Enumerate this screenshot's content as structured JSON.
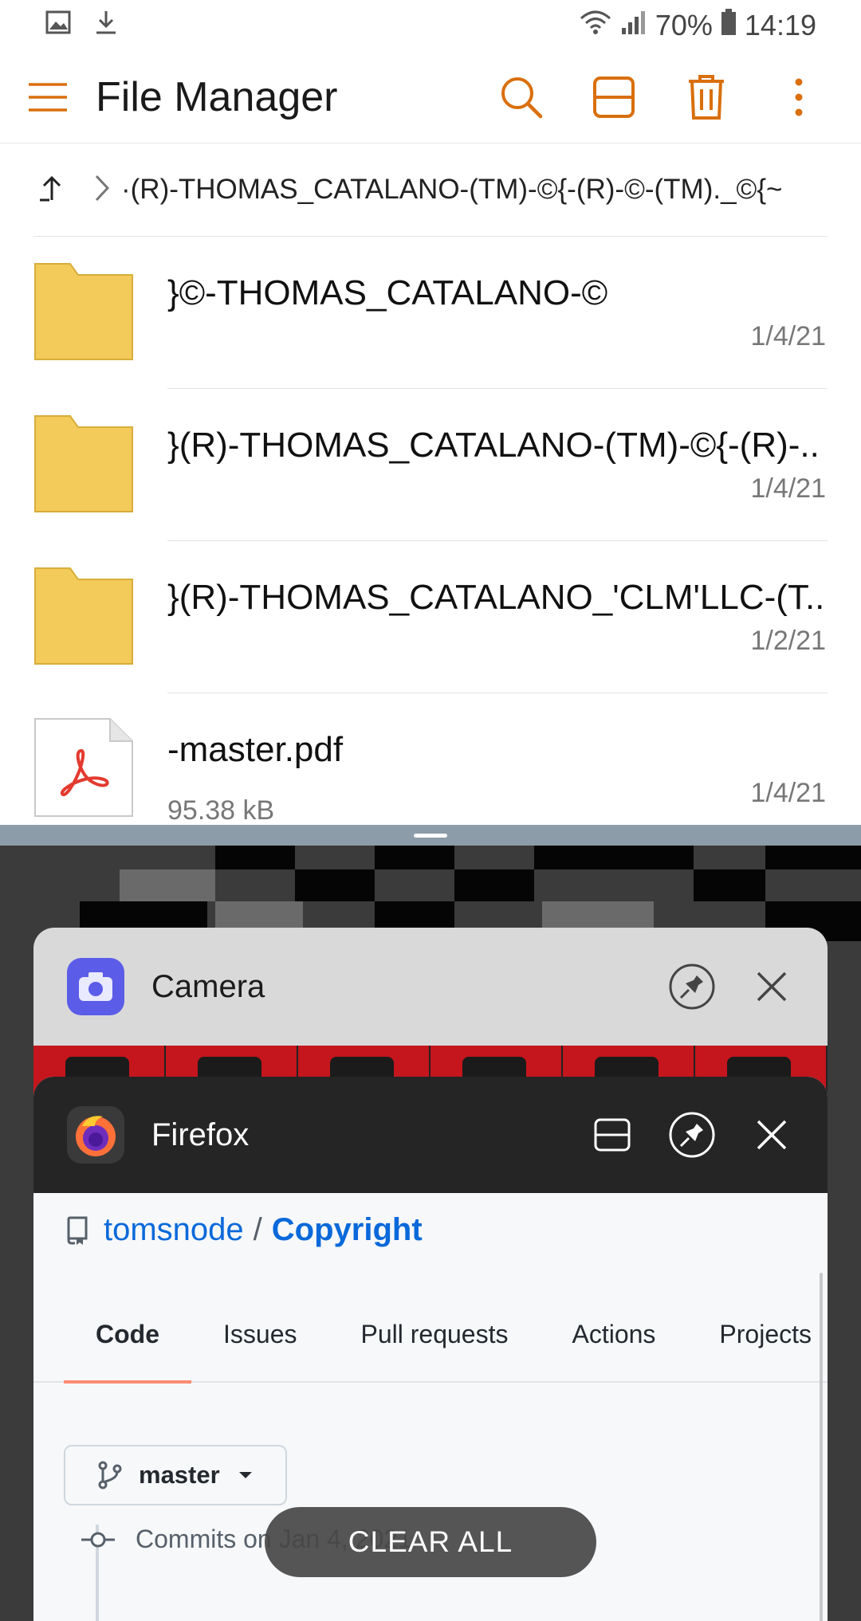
{
  "status_bar": {
    "battery": "70%",
    "time": "14:19",
    "left_icons": [
      "gallery-notification-icon",
      "download-notification-icon"
    ],
    "right_icons": [
      "wifi-icon",
      "signal-icon",
      "battery-icon"
    ]
  },
  "app_bar": {
    "title": "File Manager",
    "accent_color": "#d96f0d",
    "actions": [
      "search-icon",
      "split-view-icon",
      "trash-icon",
      "more-vert-icon"
    ]
  },
  "breadcrumb": {
    "path": "·(R)-THOMAS_CATALANO-(TM)-©{-(R)-©-(TM)._©{~"
  },
  "files": [
    {
      "type": "folder",
      "name": "}©-THOMAS_CATALANO-©",
      "size": "",
      "date": "1/4/21"
    },
    {
      "type": "folder",
      "name": "}(R)-THOMAS_CATALANO-(TM)-©{-(R)-..",
      "size": "",
      "date": "1/4/21"
    },
    {
      "type": "folder",
      "name": "}(R)-THOMAS_CATALANO_'CLM'LLC-(T..",
      "size": "",
      "date": "1/2/21"
    },
    {
      "type": "pdf",
      "name": "-master.pdf",
      "size": "95.38 kB",
      "date": "1/4/21"
    }
  ],
  "recents": {
    "camera_card": {
      "title": "Camera"
    },
    "firefox_card": {
      "title": "Firefox",
      "repo_owner": "tomsnode",
      "repo_separator": "/",
      "repo_name": "Copyright",
      "tabs": [
        "Code",
        "Issues",
        "Pull requests",
        "Actions",
        "Projects"
      ],
      "branch": "master",
      "commits_text": "Commits on Jan 4, 2021"
    },
    "clear_all_label": "CLEAR ALL"
  },
  "colors": {
    "folder": "#f2cb5a",
    "pdf_red": "#e33a2f",
    "link_blue": "#0969da",
    "firefox_header": "#252525",
    "camera_icon_bg": "#5b5ce8"
  }
}
